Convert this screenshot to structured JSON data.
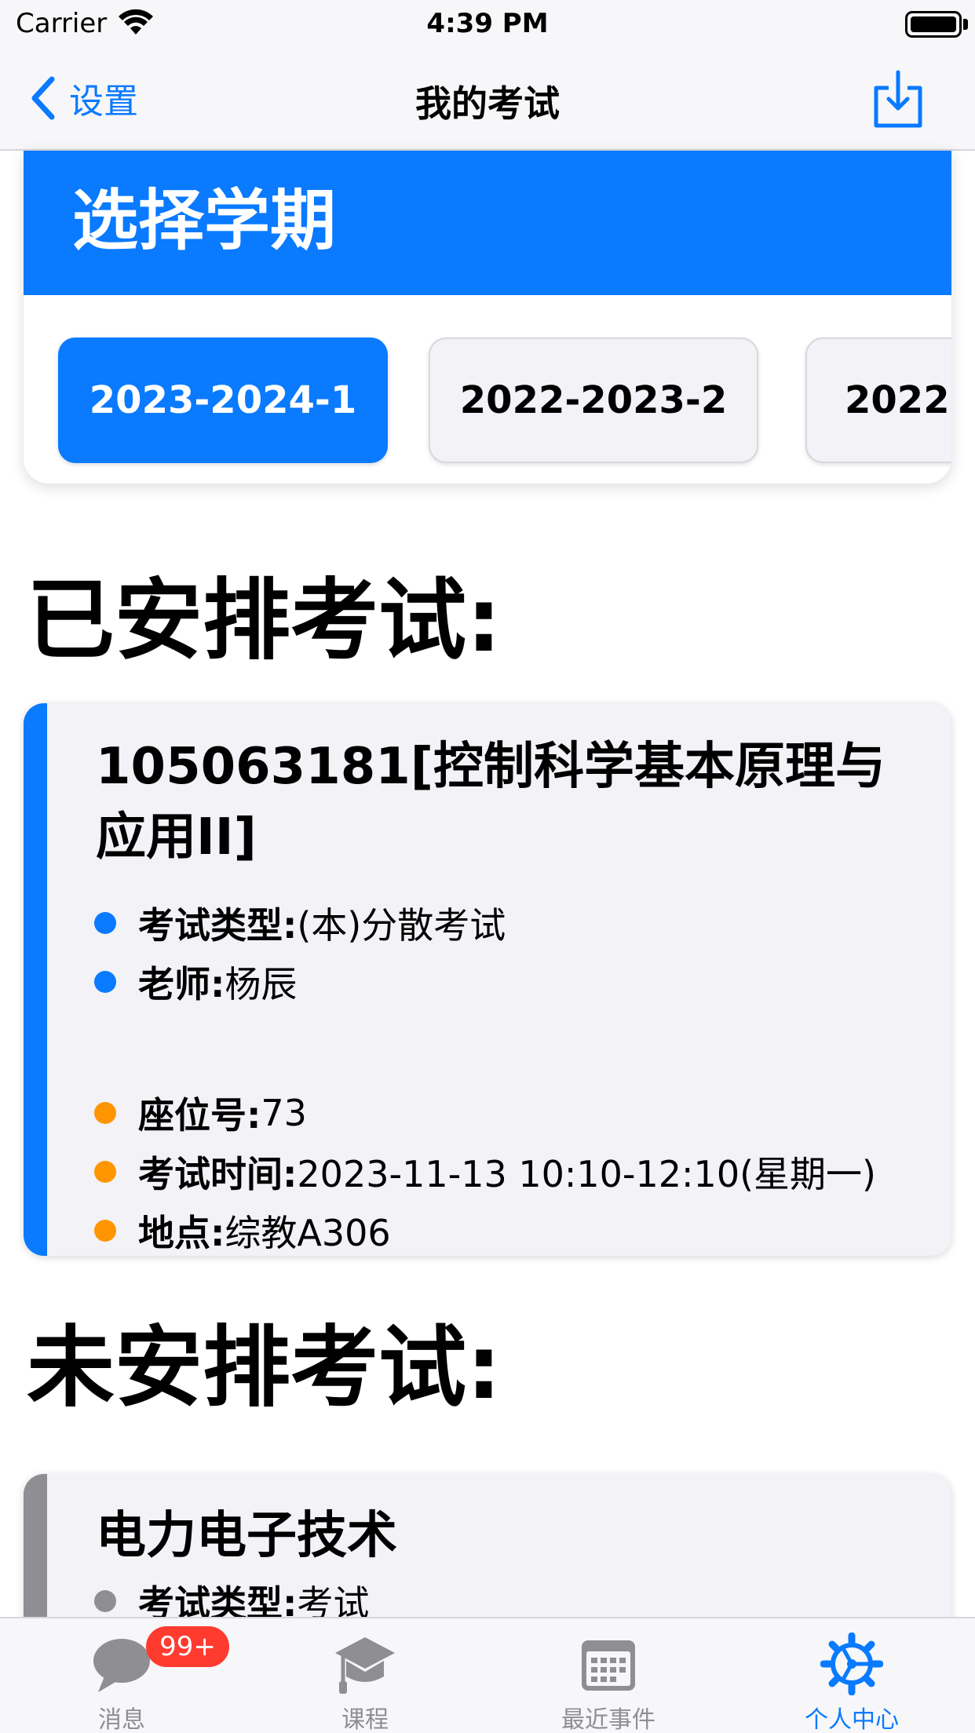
{
  "status_bar": {
    "carrier": "Carrier",
    "time": "4:39 PM",
    "wifi_icon": "wifi-icon",
    "battery_icon": "battery-icon"
  },
  "nav": {
    "back_label": "设置",
    "title": "我的考试",
    "back_icon": "chevron-left-icon",
    "action_icon": "download-icon",
    "accent_color": "#0a7aff"
  },
  "semester": {
    "title": "选择学期",
    "options": [
      "2023-2024-1",
      "2022-2023-2",
      "2022-"
    ],
    "selected": "2023-2024-1"
  },
  "arranged": {
    "title": "已安排考试:",
    "exams": [
      {
        "name": "105063181[控制科学基本原理与应用II]",
        "name_line1": "105063181[控制科学基本原理与",
        "name_line2": "应用II]",
        "type_label": "考试类型:",
        "type_value": "(本)分散考试",
        "teacher_label": "老师:",
        "teacher_value": "杨辰",
        "seat_label": "座位号:",
        "seat_value": "73",
        "time_label": "考试时间:",
        "time_value": "2023-11-13 10:10-12:10(星期一)",
        "place_label": "地点:",
        "place_value": "综教A306"
      }
    ]
  },
  "unarranged": {
    "title": "未安排考试:",
    "exams": [
      {
        "name": "电力电子技术",
        "type_label": "考试类型:",
        "type_value": "考试"
      }
    ]
  },
  "tabs": [
    {
      "label": "消息",
      "icon": "message-bubble-icon",
      "badge": "99+",
      "active": false
    },
    {
      "label": "课程",
      "icon": "graduation-cap-icon",
      "active": false
    },
    {
      "label": "最近事件",
      "icon": "calendar-icon",
      "active": false
    },
    {
      "label": "个人中心",
      "icon": "gear-icon",
      "active": true
    }
  ],
  "colors": {
    "accent": "#0a7aff",
    "orange": "#ff9500",
    "gray": "#8e8e93",
    "badge": "#ff3b30",
    "card_bg": "#f2f2f7"
  }
}
